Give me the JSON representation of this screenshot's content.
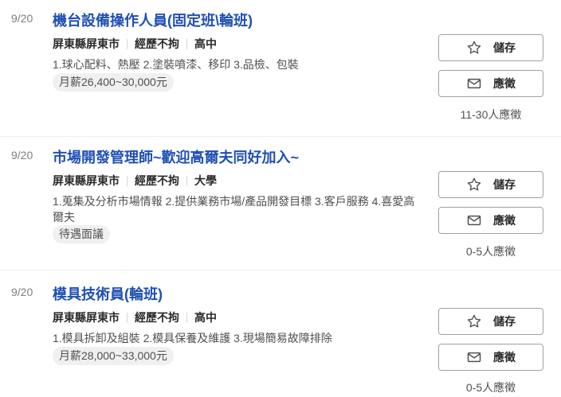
{
  "jobs": [
    {
      "date": "9/20",
      "title": "機台設備操作人員(固定班\\輪班)",
      "location": "屏東縣屏東市",
      "experience": "經歷不拘",
      "education": "高中",
      "description": "1.球心配料、熱壓 2.塗裝噴漆、移印 3.品檢、包裝",
      "salary": "月薪26,400~30,000元",
      "save_label": "儲存",
      "apply_label": "應徵",
      "applicants": "11-30人應徵"
    },
    {
      "date": "9/20",
      "title": "市場開發管理師~歡迎高爾夫同好加入~",
      "location": "屏東縣屏東市",
      "experience": "經歷不拘",
      "education": "大學",
      "description": "1.蒐集及分析市場情報 2.提供業務市場/產品開發目標 3.客戶服務 4.喜愛高爾夫",
      "salary": "待遇面議",
      "save_label": "儲存",
      "apply_label": "應徵",
      "applicants": "0-5人應徵"
    },
    {
      "date": "9/20",
      "title": "模具技術員(輪班)",
      "location": "屏東縣屏東市",
      "experience": "經歷不拘",
      "education": "高中",
      "description": "1.模具拆卸及組裝 2.模具保養及維護 3.現場簡易故障排除",
      "salary": "月薪28,000~33,000元",
      "save_label": "儲存",
      "apply_label": "應徵",
      "applicants": "0-5人應徵"
    }
  ],
  "icons": {
    "save": "star-icon",
    "apply": "envelope-icon"
  },
  "colors": {
    "title": "#1f4fb5",
    "tag_bg": "#f0f0f0",
    "button_border": "#a0a0a0"
  }
}
